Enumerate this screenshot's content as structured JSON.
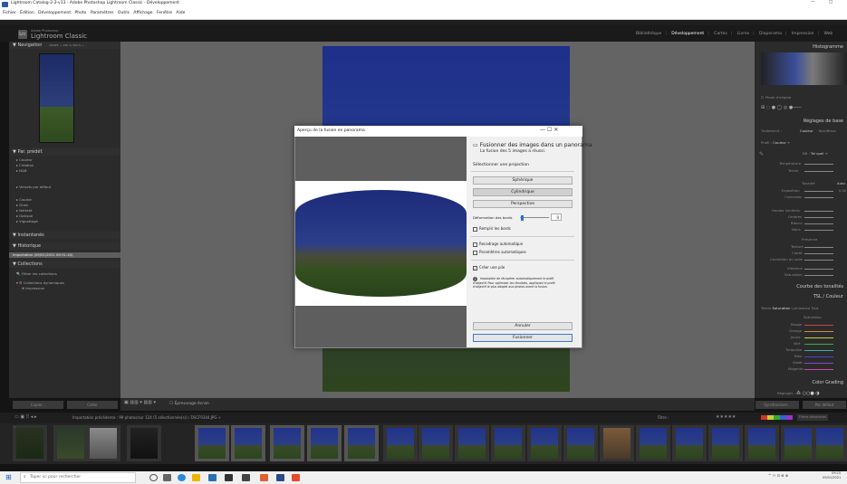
{
  "window": {
    "title": "Lightroom Catalog-2-2-v13 - Adobe Photoshop Lightroom Classic - Développement",
    "minimize": "—",
    "maximize": "□"
  },
  "menu": [
    "Fichier",
    "Édition",
    "Développement",
    "Photo",
    "Paramètres",
    "Outils",
    "Affichage",
    "Fenêtre",
    "Aide"
  ],
  "identity": {
    "logo": "Lrc",
    "small": "Adobe Photoshop",
    "name": "Lightroom Classic"
  },
  "modules": [
    "Bibliothèque",
    "Développement",
    "Cartes",
    "Livres",
    "Diaporama",
    "Impression",
    "Web"
  ],
  "left": {
    "navigator": {
      "title": "Navigation",
      "zoom": "ADAPT. ÷   100 %   300 % ÷"
    },
    "presets": {
      "title": "Par. prédéf.",
      "items": [
        "Couleur",
        "Création",
        "N&B",
        "Versets par défaut",
        "Courbe",
        "Grain",
        "Netteté",
        "Optique",
        "Vignettage"
      ]
    },
    "snapshots": {
      "title": "Instantanés"
    },
    "history": {
      "title": "Historique",
      "item": "Importation (09/01/2021 09:31:40)"
    },
    "collections": {
      "title": "Collections",
      "filter": "Filtrer les collections",
      "dynamic": "Collections dynamiques",
      "sub": "Impression"
    },
    "buttons": {
      "copy": "Copier...",
      "paste": "Coller"
    }
  },
  "right": {
    "histogram": "Histogramme",
    "photo_orig": "Photo d'origine",
    "basic": "Réglages de base",
    "traitement": "Traitement :",
    "couleur": "Couleur",
    "noir_blanc": "Noir/Blanc",
    "profil": "Profil :",
    "profil_value": "Couleur ÷",
    "wb": "BB :",
    "wb_value": "Tel quel ÷",
    "basic_sliders": [
      "Température",
      "Teinte",
      "Tonalité",
      "Exposition",
      "Contraste",
      "Hautes lumières",
      "Ombres",
      "Blancs",
      "Noirs",
      "Présence",
      "Texture",
      "Clarté",
      "Correction du voile",
      "Vibrance",
      "Saturation"
    ],
    "auto": "Auto",
    "exposure_value": "0,00",
    "tone_curve": "Courbe des tonalités",
    "hsl": "TSL / Couleur",
    "hsl_tabs": [
      "Teinte",
      "Saturation",
      "Luminance",
      "Tout"
    ],
    "hsl_title": "Saturation",
    "colors": [
      "Rouge",
      "Orange",
      "Jaune",
      "Vert",
      "Turquoise",
      "Bleu",
      "Violet",
      "Magenta"
    ],
    "color_grading": "Color Grading",
    "mode": "Réglages :",
    "sync": "Synchroniser...",
    "reset": "Par défaut"
  },
  "toolbar": {
    "label": "Épreuvage écran"
  },
  "filmbar": {
    "label": "Importation précédente  :  99 photos/sur 124 (5 sélectionnée(s))  /  DSCF9344.JPG ÷",
    "filter": "Filtre :",
    "no_filter": "Filtres désactivés"
  },
  "dialog": {
    "title": "Aperçu de la fusion en panorama",
    "controls": "—   ☐   ✕",
    "heading": "Fusionner des images dans un panorama",
    "sub": "La fusion des 5 images a réussi.",
    "projection_label": "Sélectionner une projection",
    "projections": [
      "Sphérique",
      "Cylindrique",
      "Perspective"
    ],
    "deform_label": "Déformation des bords",
    "deform_value": "0",
    "fill": "Remplir les bords",
    "auto_crop": "Recadrage automatique",
    "auto_settings": "Paramètres automatiques",
    "stack": "Créer une pile",
    "info": "Impossible de récupérer automatiquement le profil d'objectif. Pour optimiser les résultats, appliquez le profil d'objectif le plus adapté aux photos avant la fusion.",
    "cancel": "Annuler",
    "merge": "Fusionner"
  },
  "taskbar": {
    "search": "Taper ici pour rechercher",
    "tray": "^  ⚇  ⊡  ⊕  ⊗",
    "time": "09:15",
    "date": "09/01/2021"
  }
}
